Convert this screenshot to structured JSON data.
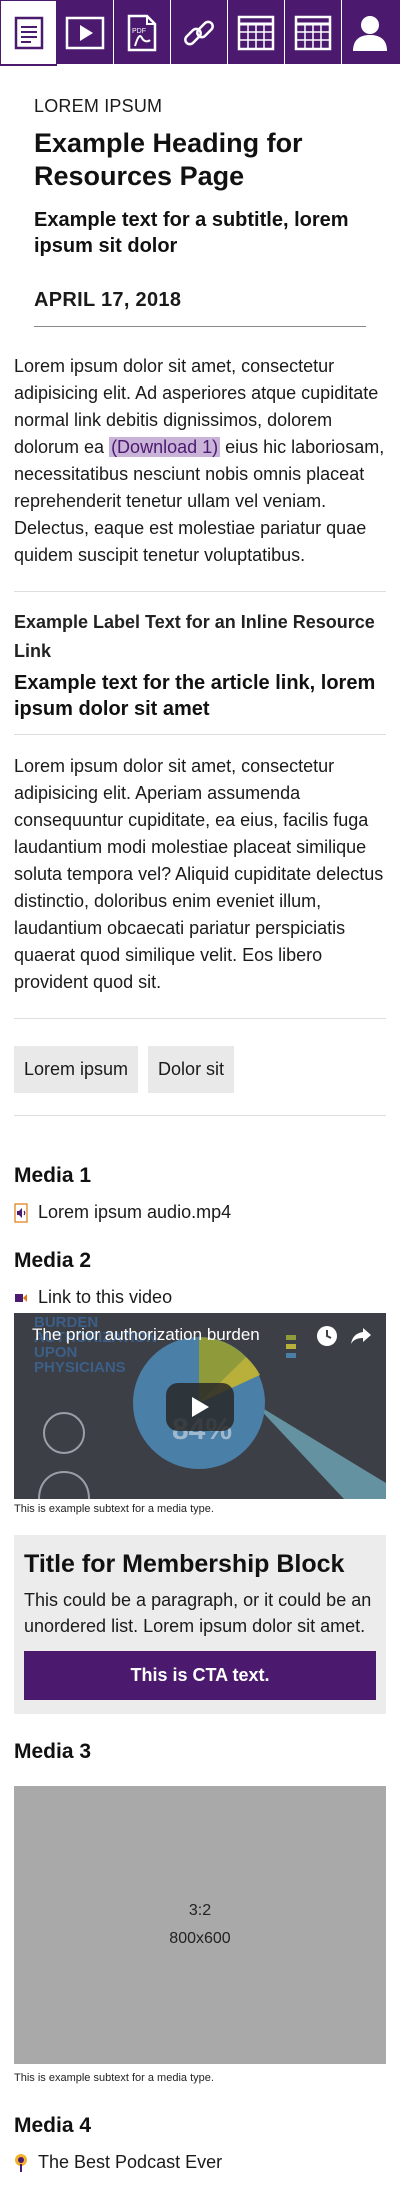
{
  "tabs": [
    {
      "icon": "document-lines-icon",
      "active": true
    },
    {
      "icon": "play-video-icon",
      "active": false
    },
    {
      "icon": "pdf-file-icon",
      "active": false
    },
    {
      "icon": "chain-link-icon",
      "active": false
    },
    {
      "icon": "table-grid-icon",
      "active": false
    },
    {
      "icon": "table-grid-icon",
      "active": false
    },
    {
      "icon": "user-icon",
      "active": false
    }
  ],
  "header": {
    "eyebrow": "LOREM IPSUM",
    "title": "Example Heading for Resources Page",
    "subtitle": "Example text for a subtitle, lorem ipsum sit dolor",
    "date": "APRIL 17, 2018"
  },
  "intro": {
    "text_before": "Lorem ipsum dolor sit amet, consectetur adipisicing elit. Ad asperiores atque cupiditate normal link debitis dignissimos, dolorem dolorum ea ",
    "link_label": "(Download 1)",
    "text_after": " eius hic laboriosam, necessitatibus nesciunt nobis omnis placeat reprehenderit tenetur ullam vel veniam. Delectus, eaque est molestiae pariatur quae quidem suscipit tenetur voluptatibus."
  },
  "inline_resource": {
    "label": "Example Label Text for an Inline Resource Link",
    "link_text": "Example text for the article link, lorem ipsum dolor sit amet"
  },
  "second_paragraph": "Lorem ipsum dolor sit amet, consectetur adipisicing elit. Aperiam assumenda consequuntur cupiditate, ea eius, facilis fuga laudantium modi molestiae placeat similique soluta tempora vel? Aliquid cupiditate delectus distinctio, doloribus enim eveniet illum, laudantium obcaecati pariatur perspiciatis quaerat quod similique velit. Eos libero provident quod sit.",
  "tags": [
    "Lorem ipsum",
    "Dolor sit"
  ],
  "media1": {
    "heading": "Media 1",
    "link": "Lorem ipsum audio.mp4",
    "icon": "audio-file-icon"
  },
  "media2": {
    "heading": "Media 2",
    "link": "Link to this video",
    "icon": "video-camera-icon",
    "video_title": "The prior authorization burden",
    "video_overlay_text": "BURDEN AUTHORIZATION UPON PHYSICIANS",
    "video_percent": "84%",
    "subtext": "This is example subtext for a media type."
  },
  "membership": {
    "title": "Title for Membership Block",
    "text": "This could be a paragraph, or it could be an unordered list. Lorem ipsum dolor sit amet.",
    "cta": "This is CTA text."
  },
  "media3": {
    "heading": "Media 3",
    "ratio": "3:2",
    "size": "800x600",
    "subtext": "This is example subtext for a media type."
  },
  "media4": {
    "heading": "Media 4",
    "link": "The Best Podcast Ever",
    "icon": "podcast-icon"
  },
  "colors": {
    "brand_purple": "#4b1a6e",
    "link_highlight": "#c9b3d9",
    "tag_bg": "#e9e9e9",
    "placeholder_bg": "#a9a9a9"
  }
}
